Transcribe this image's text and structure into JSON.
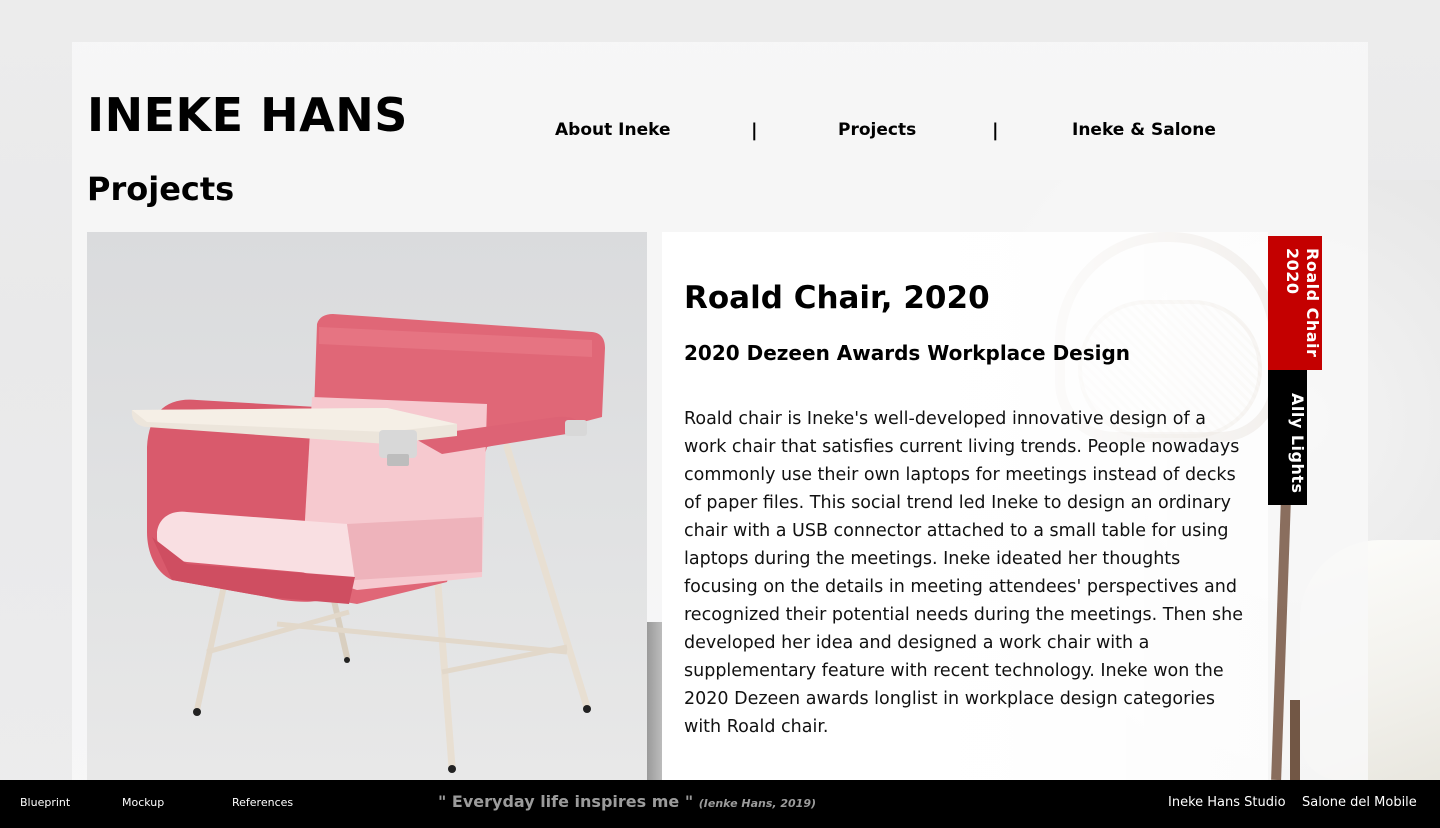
{
  "site": {
    "title": "INEKE HANS",
    "section": "Projects"
  },
  "nav": {
    "items": [
      {
        "label": "About Ineke"
      },
      {
        "label": "Projects"
      },
      {
        "label": "Ineke & Salone"
      }
    ],
    "separator": "|"
  },
  "project": {
    "title": "Roald Chair, 2020",
    "subtitle": "2020 Dezeen Awards Workplace Design",
    "description": "Roald chair is Ineke's well-developed innovative design of a work chair that satisfies current living trends. People nowadays commonly use their own laptops for meetings instead of decks of paper files. This social trend led Ineke to design an ordinary chair with a USB connector attached to a small table for using laptops during the meetings. Ineke ideated her thoughts focusing on the details in meeting attendees' perspectives and recognized their potential needs during the meetings. Then she developed her idea and designed a work chair with a supplementary feature with recent technology. Ineke won the 2020 Dezeen awards longlist in workplace design categories with Roald chair."
  },
  "project_tabs": [
    {
      "label": "Roald Chair 2020",
      "active": true,
      "color": "#c40000"
    },
    {
      "label": "Ally Lights",
      "active": false,
      "color": "#000000"
    }
  ],
  "footer": {
    "left_links": [
      {
        "label": "Blueprint"
      },
      {
        "label": "Mockup"
      },
      {
        "label": "References"
      }
    ],
    "quote": "\" Everyday life inspires me \"",
    "quote_cite": "(Ienke Hans, 2019)",
    "right_links": [
      {
        "label": "Ineke Hans Studio"
      },
      {
        "label": "Salone del Mobile"
      }
    ]
  },
  "colors": {
    "accent": "#c40000",
    "footer_bg": "#000000",
    "quote_text": "#9b9b9b"
  },
  "icons": {
    "product_image": "pink-work-chair-with-tablet-arm",
    "background_image": "bentwood-chair-photo"
  }
}
